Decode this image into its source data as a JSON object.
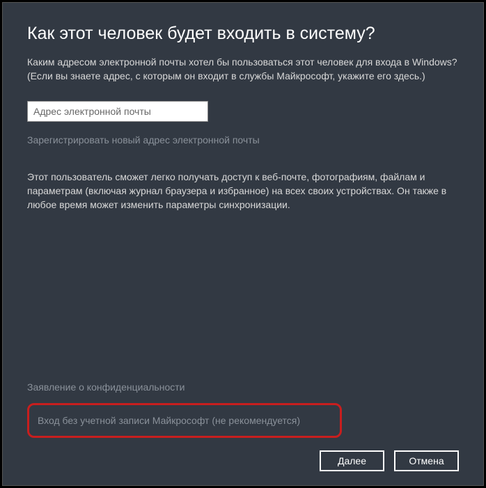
{
  "title": "Как этот человек будет входить в систему?",
  "description": "Каким адресом электронной почты хотел бы пользоваться этот человек для входа в Windows? (Если вы знаете адрес, с которым он входит в службы Майкрософт, укажите его здесь.)",
  "emailPlaceholder": "Адрес электронной почты",
  "registerLink": "Зарегистрировать новый адрес электронной почты",
  "infoText": "Этот пользователь сможет легко получать доступ к веб-почте, фотографиям, файлам и параметрам (включая журнал браузера и избранное) на всех своих устройствах. Он также в любое время может изменить параметры синхронизации.",
  "privacyLink": "Заявление о конфиденциальности",
  "noAccountLink": "Вход без учетной записи Майкрософт (не рекомендуется)",
  "buttons": {
    "next": "Далее",
    "cancel": "Отмена"
  }
}
